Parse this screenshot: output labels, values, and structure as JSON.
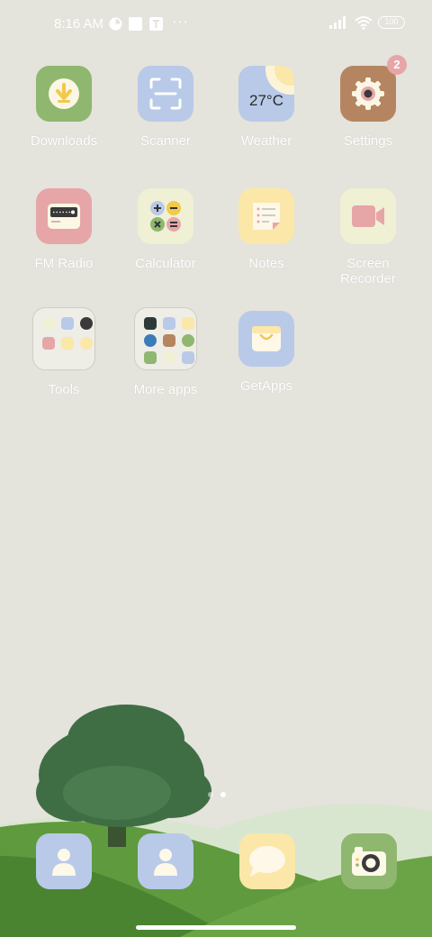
{
  "status_bar": {
    "time": "8:16 AM",
    "more": "···",
    "battery": "100"
  },
  "apps": [
    {
      "label": "Downloads",
      "icon": "download-icon",
      "color": "#8fb76f"
    },
    {
      "label": "Scanner",
      "icon": "scan-icon",
      "color": "#b9c9e8"
    },
    {
      "label": "Weather",
      "icon": "weather-icon",
      "color": "#b9c9e8",
      "temp": "27°C"
    },
    {
      "label": "Settings",
      "icon": "gear-icon",
      "color": "#b58562",
      "badge": "2"
    },
    {
      "label": "FM Radio",
      "icon": "radio-icon",
      "color": "#e6a6a8"
    },
    {
      "label": "Calculator",
      "icon": "calculator-icon",
      "color": "#eff0d4"
    },
    {
      "label": "Notes",
      "icon": "notes-icon",
      "color": "#fbe7a8"
    },
    {
      "label": "Screen\nRecorder",
      "icon": "video-camera-icon",
      "color": "#eff0d4"
    },
    {
      "label": "Tools",
      "icon": "folder-icon"
    },
    {
      "label": "More apps",
      "icon": "folder-icon"
    },
    {
      "label": "GetApps",
      "icon": "shopping-bag-icon",
      "color": "#b9c9e8"
    }
  ],
  "dock": [
    {
      "icon": "contacts-icon",
      "color": "#b9c9e8"
    },
    {
      "icon": "contacts-icon",
      "color": "#b9c9e8"
    },
    {
      "icon": "messages-icon",
      "color": "#fbe7a8"
    },
    {
      "icon": "camera-icon",
      "color": "#8fb76f"
    }
  ],
  "page_indicator": {
    "pages": 2,
    "current": 2
  }
}
